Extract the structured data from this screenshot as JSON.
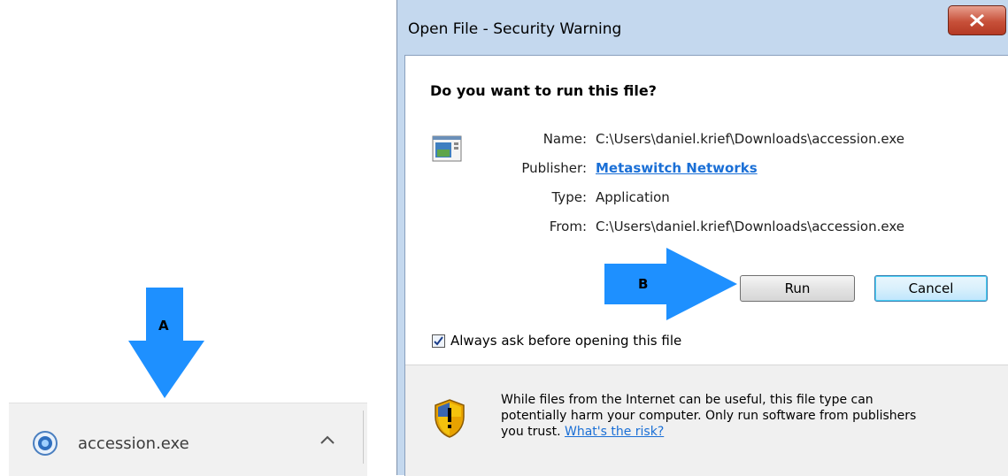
{
  "download_bar": {
    "file_name": "accession.exe"
  },
  "annotations": {
    "arrow_a_label": "A",
    "arrow_b_label": "B",
    "arrow_color": "#1e90ff"
  },
  "dialog": {
    "title": "Open File - Security Warning",
    "question": "Do you want to run this file?",
    "fields": {
      "name_label": "Name:",
      "name_value": "C:\\Users\\daniel.krief\\Downloads\\accession.exe",
      "publisher_label": "Publisher:",
      "publisher_value": "Metaswitch Networks",
      "type_label": "Type:",
      "type_value": "Application",
      "from_label": "From:",
      "from_value": "C:\\Users\\daniel.krief\\Downloads\\accession.exe"
    },
    "buttons": {
      "run": "Run",
      "cancel": "Cancel"
    },
    "checkbox": {
      "label": "Always ask before opening this file",
      "checked": true
    },
    "warning": {
      "line1": "While files from the Internet can be useful, this file type can",
      "line2": "potentially harm your computer. Only run software from publishers",
      "line3": "you trust.",
      "link": "What's the risk?"
    }
  }
}
